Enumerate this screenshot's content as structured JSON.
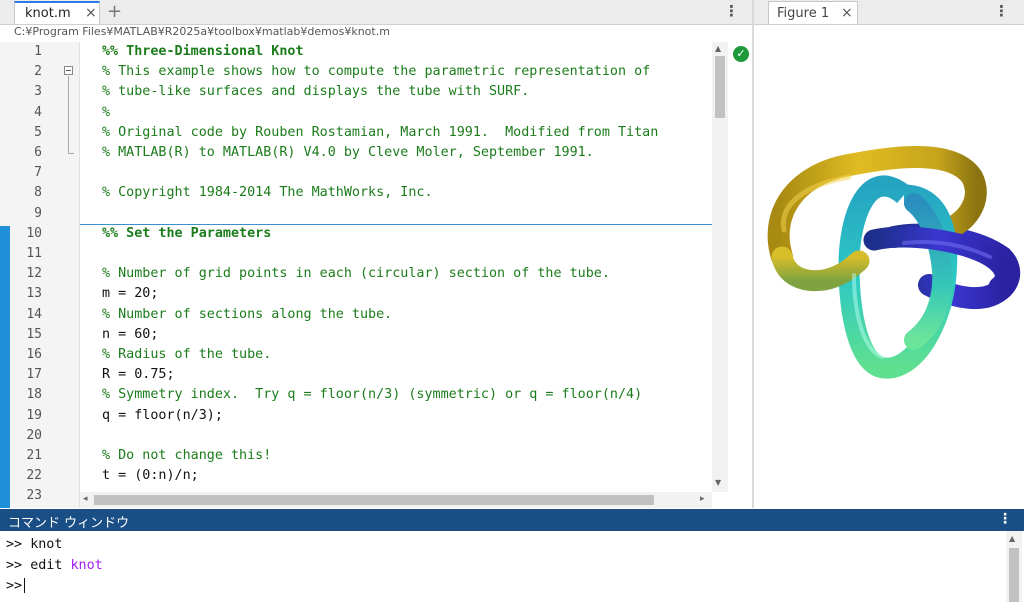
{
  "editor": {
    "tab_label": "knot.m",
    "tab_close": "×",
    "add_tab": "+",
    "menu": "⋮",
    "file_path": "C:¥Program Files¥MATLAB¥R2025a¥toolbox¥matlab¥demos¥knot.m",
    "status_icon": "check-circle-icon",
    "lines": [
      {
        "n": "1",
        "text": "%% Three-Dimensional Knot",
        "kind": "section"
      },
      {
        "n": "2",
        "text": "% This example shows how to compute the parametric representation of",
        "kind": "comment"
      },
      {
        "n": "3",
        "text": "% tube-like surfaces and displays the tube with SURF.",
        "kind": "comment"
      },
      {
        "n": "4",
        "text": "%",
        "kind": "comment"
      },
      {
        "n": "5",
        "text": "% Original code by Rouben Rostamian, March 1991.  Modified from Titan",
        "kind": "comment"
      },
      {
        "n": "6",
        "text": "% MATLAB(R) to MATLAB(R) V4.0 by Cleve Moler, September 1991.",
        "kind": "comment"
      },
      {
        "n": "7",
        "text": "",
        "kind": "code"
      },
      {
        "n": "8",
        "text": "% Copyright 1984-2014 The MathWorks, Inc.",
        "kind": "comment"
      },
      {
        "n": "9",
        "text": "",
        "kind": "code"
      },
      {
        "n": "10",
        "text": "%% Set the Parameters",
        "kind": "section"
      },
      {
        "n": "11",
        "text": "",
        "kind": "code"
      },
      {
        "n": "12",
        "text": "% Number of grid points in each (circular) section of the tube.",
        "kind": "comment"
      },
      {
        "n": "13",
        "text": "m = 20;",
        "kind": "code"
      },
      {
        "n": "14",
        "text": "% Number of sections along the tube.",
        "kind": "comment"
      },
      {
        "n": "15",
        "text": "n = 60;",
        "kind": "code"
      },
      {
        "n": "16",
        "text": "% Radius of the tube.",
        "kind": "comment"
      },
      {
        "n": "17",
        "text": "R = 0.75;",
        "kind": "code"
      },
      {
        "n": "18",
        "text": "% Symmetry index.  Try q = floor(n/3) (symmetric) or q = floor(n/4)",
        "kind": "comment"
      },
      {
        "n": "19",
        "text": "q = floor(n/3);",
        "kind": "code"
      },
      {
        "n": "20",
        "text": "",
        "kind": "code"
      },
      {
        "n": "21",
        "text": "% Do not change this!",
        "kind": "comment"
      },
      {
        "n": "22",
        "text": "t = (0:n)/n;",
        "kind": "code"
      },
      {
        "n": "23",
        "text": "",
        "kind": "code"
      }
    ]
  },
  "figure": {
    "tab_label": "Figure 1",
    "tab_close": "×",
    "menu": "⋮",
    "image": "knot-tube-surface-3d-plot",
    "colors": {
      "yellow": "#d8b21c",
      "cyan": "#2fc6c8",
      "green": "#5fe09a",
      "blue": "#2c2bb8"
    }
  },
  "command_window": {
    "title": "コマンド ウィンドウ",
    "menu": "⋮",
    "prompt": ">>",
    "history": [
      {
        "cmd": "knot",
        "arg": ""
      },
      {
        "cmd": "edit",
        "arg": "knot"
      }
    ]
  },
  "colors": {
    "comment": "#1b7c1b",
    "section_bar": "#1e8fd8",
    "command_header": "#1a4f86",
    "argument": "#a020f0"
  }
}
